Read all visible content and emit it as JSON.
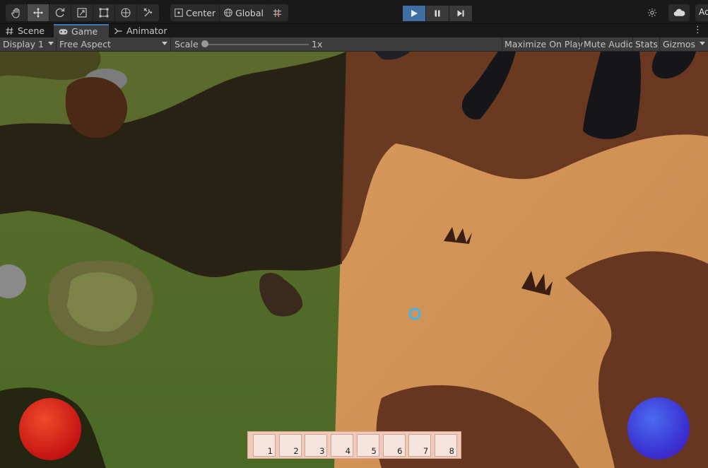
{
  "toolbar": {
    "tools": [
      {
        "name": "hand-tool-button",
        "icon": "hand-icon"
      },
      {
        "name": "move-tool-button",
        "icon": "move-icon",
        "active": true
      },
      {
        "name": "rotate-tool-button",
        "icon": "rotate-icon"
      },
      {
        "name": "scale-tool-button",
        "icon": "scale-icon"
      },
      {
        "name": "rect-tool-button",
        "icon": "rect-transform-icon"
      },
      {
        "name": "transform-tool-button",
        "icon": "transform-icon"
      },
      {
        "name": "custom-tool-button",
        "icon": "tools-icon"
      }
    ],
    "pivot_label": "Center",
    "space_label": "Global",
    "grid_snap_icon": "grid-snap-icon",
    "play_controls": [
      "play-icon",
      "pause-icon",
      "step-icon"
    ],
    "account_label": "Ac",
    "accent_color": "#3f6ea3"
  },
  "tabs": [
    {
      "label": "Scene",
      "icon": "hash-icon"
    },
    {
      "label": "Game",
      "icon": "gamepad-icon",
      "active": true
    },
    {
      "label": "Animator",
      "icon": "animator-icon"
    }
  ],
  "game_bar": {
    "display": "Display 1",
    "aspect": "Free Aspect",
    "scale_label": "Scale",
    "scale_value": "1x",
    "scale_fraction": 0.0,
    "maximize_on_play": "Maximize On Play",
    "mute_audio": "Mute Audio",
    "stats": "Stats",
    "gizmos": "Gizmos"
  },
  "hud": {
    "slots": [
      "1",
      "2",
      "3",
      "4",
      "5",
      "6",
      "7",
      "8"
    ],
    "left_orb_color": "#d91a1a",
    "right_orb_color": "#3a2fd0"
  }
}
